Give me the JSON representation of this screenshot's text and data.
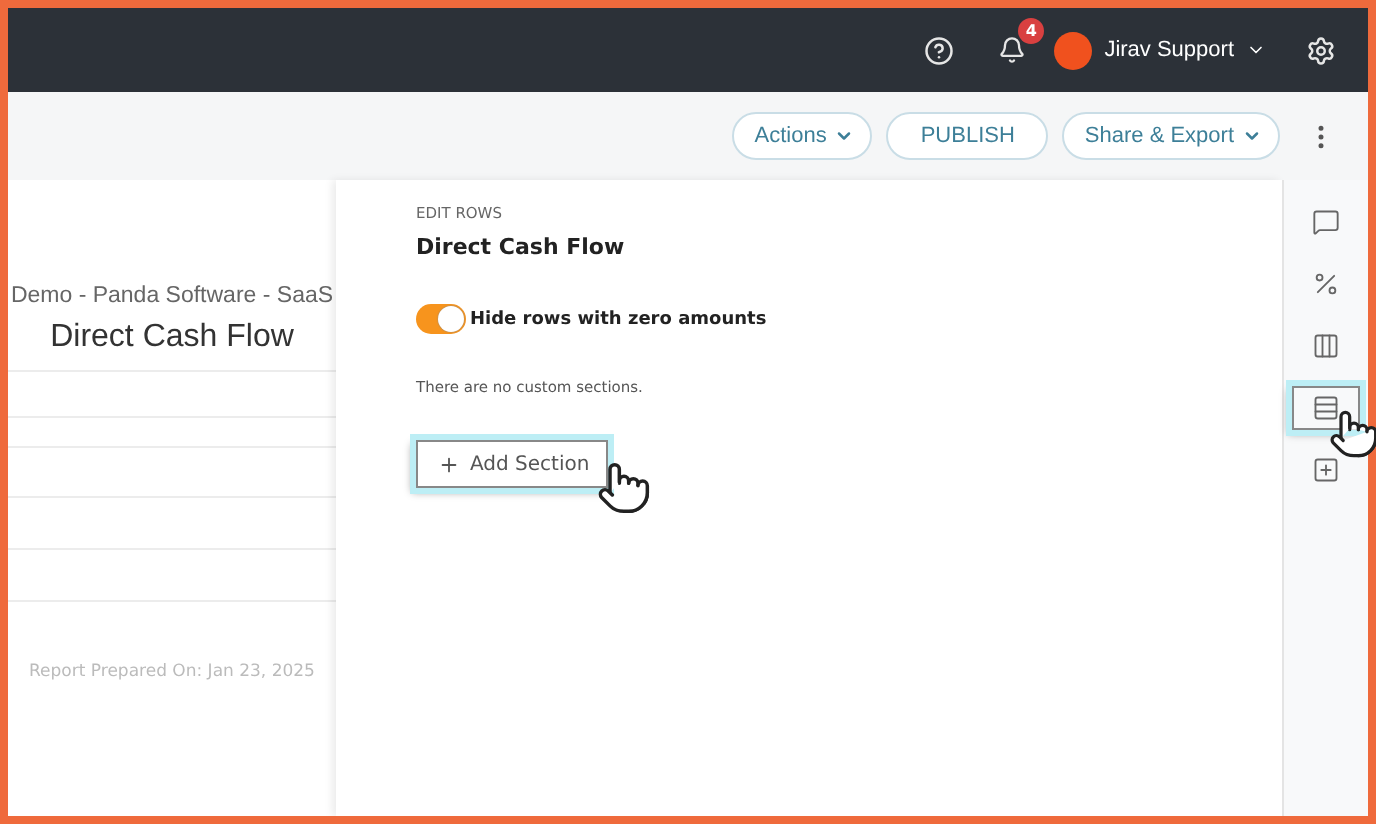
{
  "header": {
    "notification_count": "4",
    "user_name": "Jirav Support"
  },
  "toolbar": {
    "buttons": [
      {
        "label": "Actions",
        "kind": "dropdown"
      },
      {
        "label": "PUBLISH",
        "kind": "plain"
      },
      {
        "label": "Share & Export",
        "kind": "dropdown"
      }
    ]
  },
  "report": {
    "company": "Demo - Panda Software - SaaS",
    "title": "Direct Cash Flow",
    "prepared": "Report Prepared On: Jan 23, 2025"
  },
  "editor": {
    "section_label": "EDIT ROWS",
    "title": "Direct Cash Flow",
    "toggle": {
      "label": "Hide rows with zero amounts",
      "on": true
    },
    "empty_text": "There are no custom sections.",
    "add_button": "Add Section"
  },
  "rail": [
    {
      "kind": "comment",
      "selected": false
    },
    {
      "kind": "percent",
      "selected": false
    },
    {
      "kind": "columns",
      "selected": false
    },
    {
      "kind": "rows",
      "selected": true
    },
    {
      "kind": "add-table",
      "selected": false
    }
  ]
}
